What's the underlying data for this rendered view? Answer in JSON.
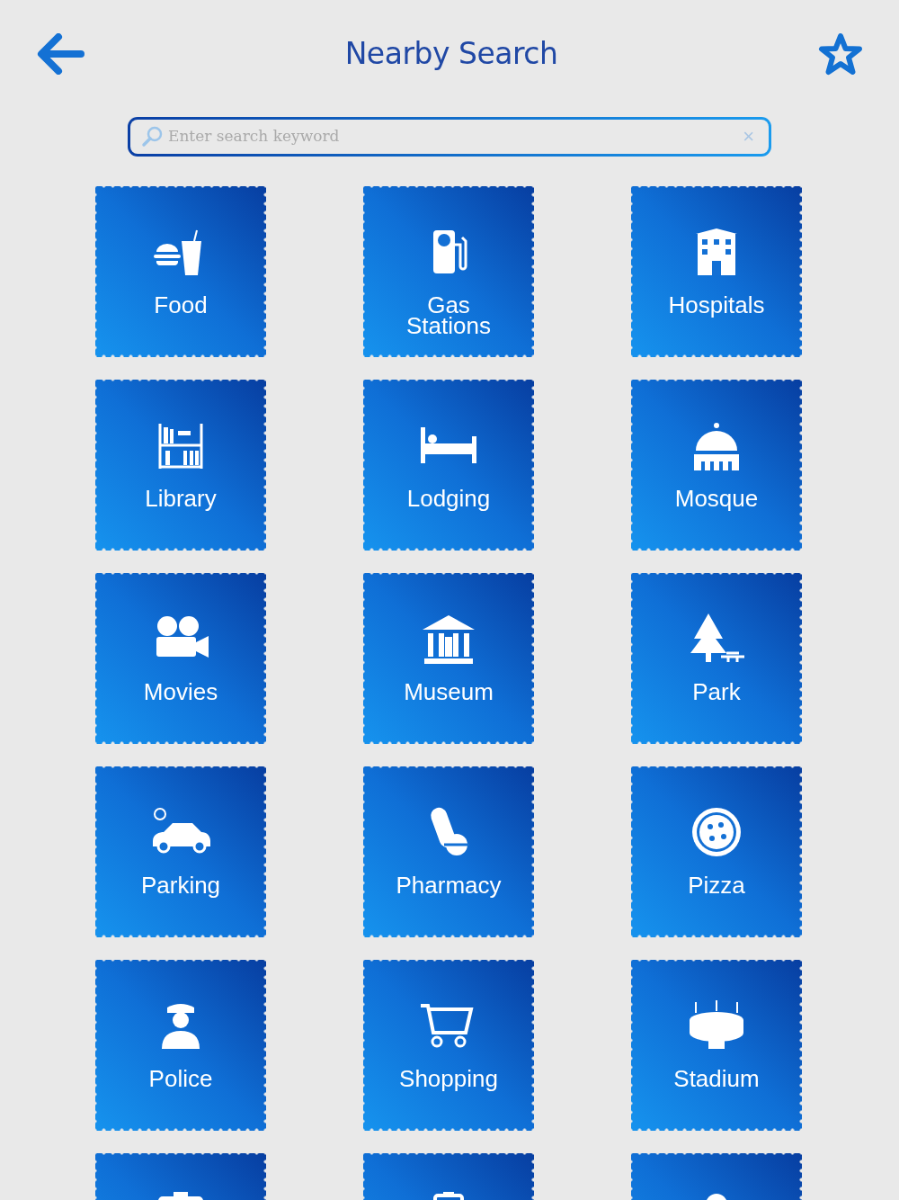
{
  "header": {
    "title": "Nearby Search"
  },
  "search": {
    "placeholder": "Enter search keyword",
    "clear": "×"
  },
  "tiles": [
    {
      "kind": "category",
      "label": "Food"
    },
    {
      "kind": "category",
      "label": "Gas Stations"
    },
    {
      "kind": "category",
      "label": "Hospitals"
    },
    {
      "kind": "category",
      "label": "Library"
    },
    {
      "kind": "category",
      "label": "Lodging"
    },
    {
      "kind": "category",
      "label": "Mosque"
    },
    {
      "kind": "category",
      "label": "Movies"
    },
    {
      "kind": "category",
      "label": "Museum"
    },
    {
      "kind": "category",
      "label": "Park"
    },
    {
      "kind": "category",
      "label": "Parking"
    },
    {
      "kind": "category",
      "label": "Pharmacy"
    },
    {
      "kind": "category",
      "label": "Pizza"
    },
    {
      "kind": "category",
      "label": "Police"
    },
    {
      "kind": "category",
      "label": "Shopping"
    },
    {
      "kind": "category",
      "label": "Stadium"
    },
    {
      "kind": "cut_off"
    },
    {
      "kind": "cut_off"
    },
    {
      "kind": "cut_off"
    }
  ]
}
